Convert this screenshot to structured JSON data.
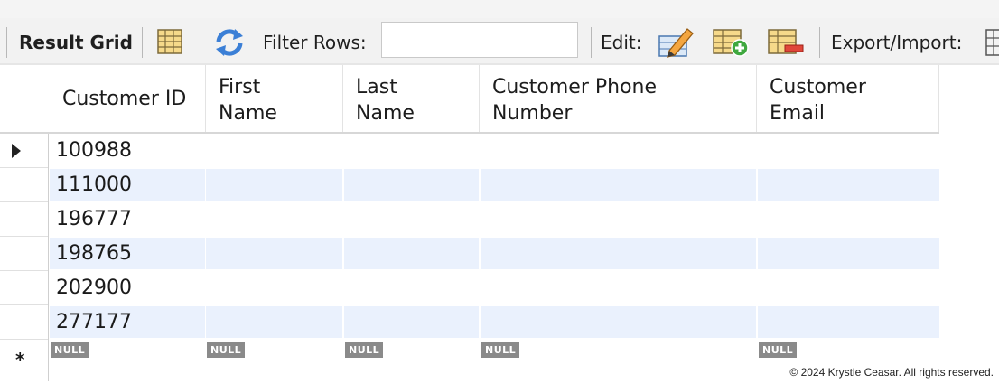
{
  "toolbar": {
    "result_grid_label": "Result Grid",
    "filter_rows_label": "Filter Rows:",
    "filter_rows_value": "",
    "edit_label": "Edit:",
    "export_import_label": "Export/Import:"
  },
  "grid": {
    "columns": [
      "Customer ID",
      "First\nName",
      "Last\nName",
      "Customer Phone\nNumber",
      "Customer\nEmail"
    ],
    "rows": [
      [
        "100988",
        "",
        "",
        "",
        ""
      ],
      [
        "111000",
        "",
        "",
        "",
        ""
      ],
      [
        "196777",
        "",
        "",
        "",
        ""
      ],
      [
        "198765",
        "",
        "",
        "",
        ""
      ],
      [
        "202900",
        "",
        "",
        "",
        ""
      ],
      [
        "277177",
        "",
        "",
        "",
        ""
      ]
    ],
    "new_row_marker": "*",
    "new_row_values": [
      "NULL",
      "NULL",
      "NULL",
      "NULL",
      "NULL"
    ]
  },
  "icons": {
    "grid_view": "grid-view-icon",
    "refresh": "refresh-icon",
    "edit_row": "edit-pencil-icon",
    "add_row": "add-row-icon",
    "delete_row": "delete-row-icon",
    "export_grid": "export-grid-icon"
  },
  "colors": {
    "alt_row": "#eaf1fd",
    "null_badge": "#8a8a8a",
    "toolbar_bg": "#f2f2f2"
  },
  "footer": {
    "copyright": "© 2024 Krystle Ceasar. All rights reserved."
  }
}
